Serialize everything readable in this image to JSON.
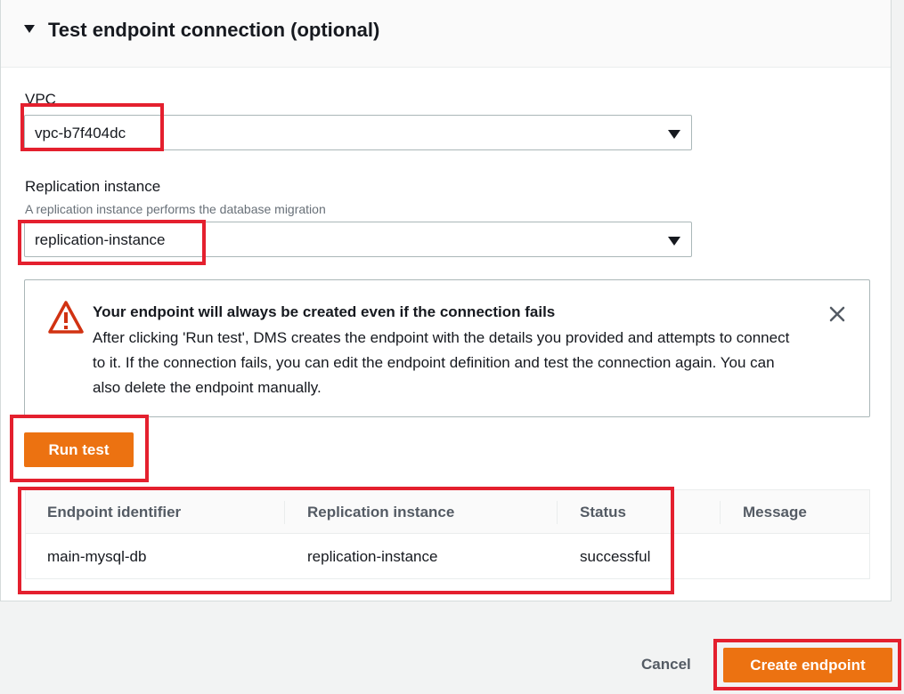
{
  "section": {
    "title": "Test endpoint connection (optional)"
  },
  "vpc": {
    "label": "VPC",
    "value": "vpc-b7f404dc"
  },
  "replication": {
    "label": "Replication instance",
    "description": "A replication instance performs the database migration",
    "value": "replication-instance"
  },
  "alert": {
    "title": "Your endpoint will always be created even if the connection fails",
    "body": "After clicking 'Run test', DMS creates the endpoint with the details you provided and attempts to connect to it. If the connection fails, you can edit the endpoint definition and test the connection again. You can also delete the endpoint manually."
  },
  "buttons": {
    "run_test": "Run test",
    "cancel": "Cancel",
    "create_endpoint": "Create endpoint"
  },
  "results_table": {
    "columns": [
      "Endpoint identifier",
      "Replication instance",
      "Status",
      "Message"
    ],
    "rows": [
      [
        "main-mysql-db",
        "replication-instance",
        "successful",
        ""
      ]
    ]
  },
  "colors": {
    "primary": "#ec7211",
    "highlight": "#e4202e"
  }
}
